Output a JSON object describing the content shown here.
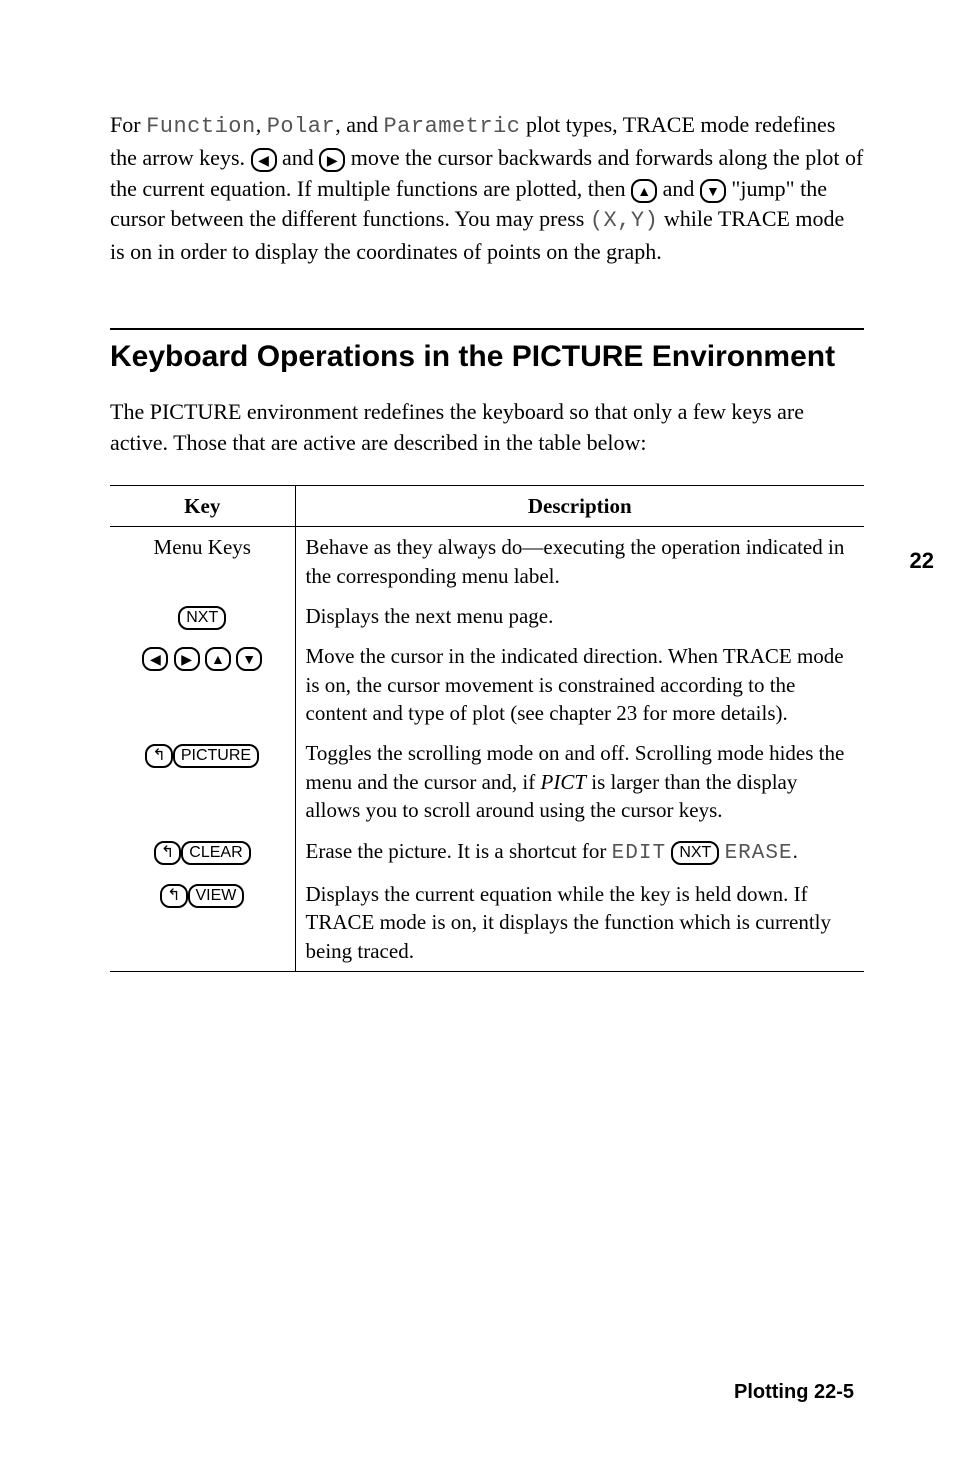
{
  "intro": {
    "p1a": "For ",
    "mono1": "Function",
    "comma1": ", ",
    "mono2": "Polar",
    "comma2": ", and ",
    "mono3": "Parametric",
    "p1b": " plot types, TRACE mode redefines the arrow keys. ",
    "key_left": "◀",
    "p1c": " and ",
    "key_right": "▶",
    "p1d": " move the cursor backwards and forwards along the plot of the current equation. If multiple functions are plotted, then ",
    "key_up": "▲",
    "p1e": " and ",
    "key_down": "▼",
    "p1f": " \"jump\" the cursor between the different functions. You may press ",
    "xy": "(X,Y)",
    "p1g": " while TRACE mode is on in order to display the coordinates of points on the graph."
  },
  "section": {
    "title": "Keyboard Operations in the PICTURE Environment",
    "body": "The PICTURE environment redefines the keyboard so that only a few keys are active. Those that are active are described in the table below:"
  },
  "table": {
    "head_key": "Key",
    "head_desc": "Description",
    "rows": [
      {
        "key_text": "Menu Keys",
        "desc": "Behave as they always do—executing the operation indicated in the corresponding menu label."
      },
      {
        "key_cap": "NXT",
        "desc": "Displays the next menu page."
      },
      {
        "arrows": [
          "◀",
          "▶",
          "▲",
          "▼"
        ],
        "desc": "Move the cursor in the indicated direction. When TRACE mode is on, the cursor movement is constrained according to the content and type of plot (see chapter 23 for more details)."
      },
      {
        "shift": "↰",
        "key_cap": "PICTURE",
        "desc_a": "Toggles the scrolling mode on and off. Scrolling mode hides the menu and the cursor and, if ",
        "pict": "PICT",
        "desc_b": " is larger than the display allows you to scroll around using the cursor keys."
      },
      {
        "shift": "↰",
        "key_cap": "CLEAR",
        "desc_a": "Erase the picture. It is a shortcut for ",
        "lcd1": "EDIT",
        "nxt": "NXT",
        "lcd2": "ERASE",
        "desc_b": "."
      },
      {
        "shift": "↰",
        "key_cap": "VIEW",
        "desc": "Displays the current equation while the key is held down. If TRACE mode is on, it displays the function which is currently being traced."
      }
    ]
  },
  "margin_tab": "22",
  "footer": "Plotting   22-5"
}
